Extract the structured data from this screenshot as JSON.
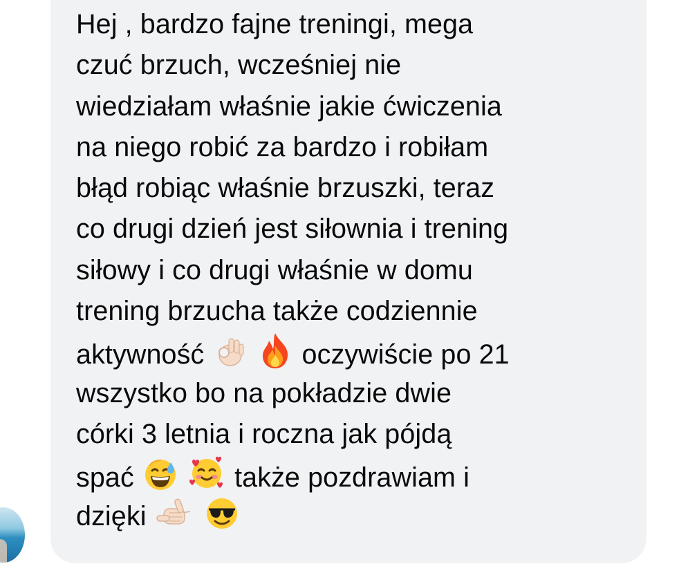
{
  "message": {
    "lines": [
      "Hej , bardzo fajne treningi, mega",
      "czuć brzuch, wcześniej nie",
      "wiedziałam właśnie jakie ćwiczenia",
      "na niego robić za bardzo i robiłam",
      "błąd robiąc właśnie brzuszki, teraz",
      "co drugi dzień jest siłownia i trening",
      "siłowy i co drugi właśnie w domu",
      "trening brzucha także codziennie"
    ],
    "line9_part1": "aktywność",
    "line9_part2": "oczywiście po 21",
    "line10": "wszystko bo na pokładzie dwie",
    "line11": "córki 3 letnia i roczna jak pójdą",
    "line12_part1": "spać",
    "line12_part2": "także pozdrawiam i",
    "line13": "dzięki"
  },
  "emojis": {
    "ok_hand": "ok-hand-icon",
    "fire": "fire-icon",
    "sweat_smile": "grinning-sweat-icon",
    "hearts_face": "smiling-face-with-hearts-icon",
    "call_me": "call-me-hand-icon",
    "sunglasses": "sunglasses-face-icon"
  },
  "colors": {
    "bubble": "#f1f2f4",
    "text": "#0a0a0a"
  }
}
